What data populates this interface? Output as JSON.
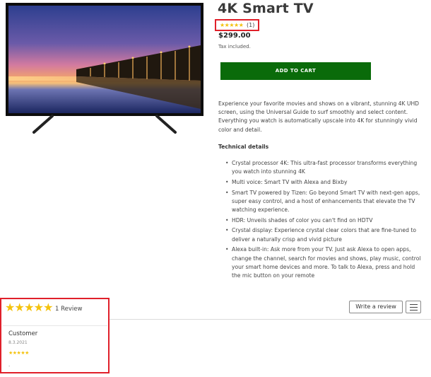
{
  "product": {
    "title": "4K Smart TV",
    "rating_stars": "★★★★★",
    "rating_count": "(1)",
    "price": "$299.00",
    "tax_note": "Tax included.",
    "add_to_cart_label": "ADD TO CART",
    "image_icon": "tv-image",
    "description": "Experience your favorite movies and shows on a vibrant, stunning 4K UHD screen, using the Universal Guide to surf smoothly and select content. Everything you watch is automatically upscale into 4K for stunningly vivid color and detail.",
    "technical_details_title": "Technical details",
    "features": [
      "Crystal processor 4K: This ultra-fast processor transforms everything you watch into stunning 4K",
      "Multi voice: Smart TV with Alexa and Bixby",
      "Smart TV powered by Tizen: Go beyond Smart TV with next-gen apps, super easy control, and a host of enhancements that elevate the TV watching experience.",
      "HDR: Unveils shades of color you can't find on HDTV",
      "Crystal display: Experience crystal clear colors that are fine-tuned to deliver a naturally crisp and vivid picture",
      "Alexa built-in: Ask more from your TV. Just ask Alexa to open apps, change the channel, search for movies and shows, play music, control your smart home devices and more. To talk to Alexa, press and hold the mic button on your remote"
    ]
  },
  "reviews": {
    "summary_stars": "★★★★★",
    "summary_count": "1 Review",
    "write_review_label": "Write a review",
    "menu_icon": "hamburger-menu-icon",
    "items": [
      {
        "author": "Customer",
        "date": "8.3.2021",
        "stars": "★★★★★",
        "body": "."
      }
    ]
  },
  "colors": {
    "cart_button": "#0a6b0a",
    "highlight_border": "#e0202a",
    "star": "#f4c20d"
  }
}
